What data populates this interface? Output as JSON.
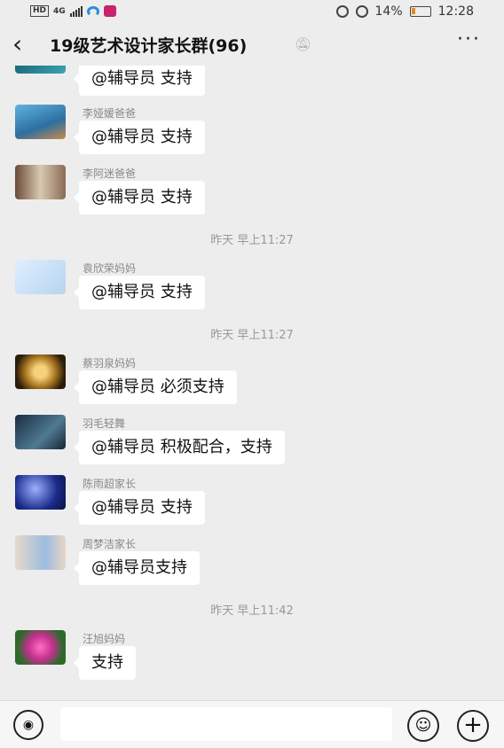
{
  "status_bar": {
    "hd": "HD",
    "network": "4G",
    "battery_percent": "14%",
    "time": "12:28"
  },
  "header": {
    "back_icon": "back-arrow-icon",
    "title": "19级艺术设计家长群(96)",
    "mute_icon": "mute-bell-icon",
    "more_label": "···"
  },
  "messages": [
    {
      "sender": "",
      "text": "@辅导员  支持",
      "avatar_icon": "avatar-image"
    },
    {
      "sender": "李娅媛爸爸",
      "text": "@辅导员  支持",
      "avatar_icon": "avatar-image"
    },
    {
      "sender": "李阿迷爸爸",
      "text": "@辅导员  支持",
      "avatar_icon": "avatar-image"
    },
    {
      "sender": "袁欣荣妈妈",
      "text": "@辅导员  支持",
      "avatar_icon": "avatar-image"
    },
    {
      "sender": "蔡羽泉妈妈",
      "text": "@辅导员  必须支持",
      "avatar_icon": "avatar-image"
    },
    {
      "sender": "羽毛轻舞",
      "text": "@辅导员  积极配合，支持",
      "avatar_icon": "avatar-image"
    },
    {
      "sender": "陈雨超家长",
      "text": "@辅导员  支持",
      "avatar_icon": "avatar-image"
    },
    {
      "sender": "周梦洁家长",
      "text": "@辅导员支持",
      "avatar_icon": "avatar-image"
    },
    {
      "sender": "汪旭妈妈",
      "text": "支持",
      "avatar_icon": "avatar-image"
    }
  ],
  "timestamps": [
    "昨天 早上11:27",
    "昨天 早上11:27",
    "昨天 早上11:42"
  ],
  "input_bar": {
    "voice_icon": "voice-icon",
    "emoji_icon": "emoji-icon",
    "plus_icon": "plus-icon",
    "text_value": ""
  },
  "colors": {
    "background": "#ededed",
    "bubble": "#ffffff",
    "sender_text": "#888888",
    "timestamp_text": "#999999"
  }
}
